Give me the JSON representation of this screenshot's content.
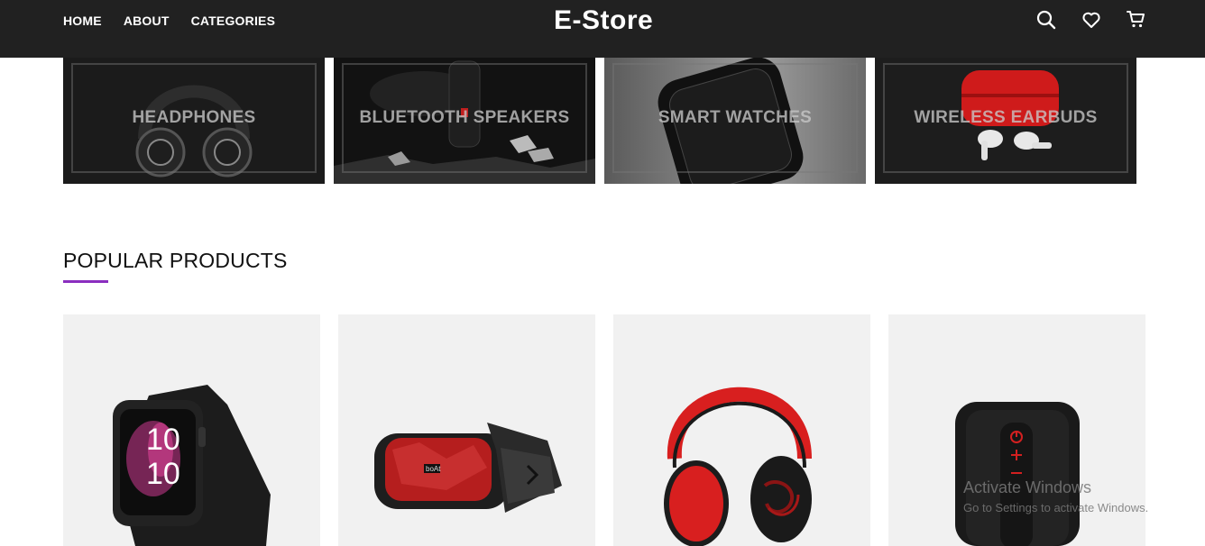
{
  "nav": {
    "links": [
      "HOME",
      "ABOUT",
      "CATEGORIES"
    ],
    "brand": "E-Store",
    "icons": [
      "search-icon",
      "heart-icon",
      "cart-icon"
    ]
  },
  "categories": [
    {
      "label": "HEADPHONES"
    },
    {
      "label": "BLUETOOTH SPEAKERS"
    },
    {
      "label": "SMART WATCHES"
    },
    {
      "label": "WIRELESS EARBUDS"
    }
  ],
  "popular": {
    "title": "POPULAR PRODUCTS",
    "accent_color": "#8a2ebf"
  },
  "products": [
    {
      "kind": "smart-watch",
      "watch_time_top": "10",
      "watch_time_bottom": "10"
    },
    {
      "kind": "bluetooth-speaker",
      "brand_mark": "boAt"
    },
    {
      "kind": "headphones"
    },
    {
      "kind": "cylinder-speaker"
    }
  ],
  "watermark": {
    "title": "Activate Windows",
    "subtitle": "Go to Settings to activate Windows."
  },
  "colors": {
    "header_bg": "#212121",
    "product_card_bg": "#f1f1f1",
    "headphone_red": "#d81f1f"
  }
}
